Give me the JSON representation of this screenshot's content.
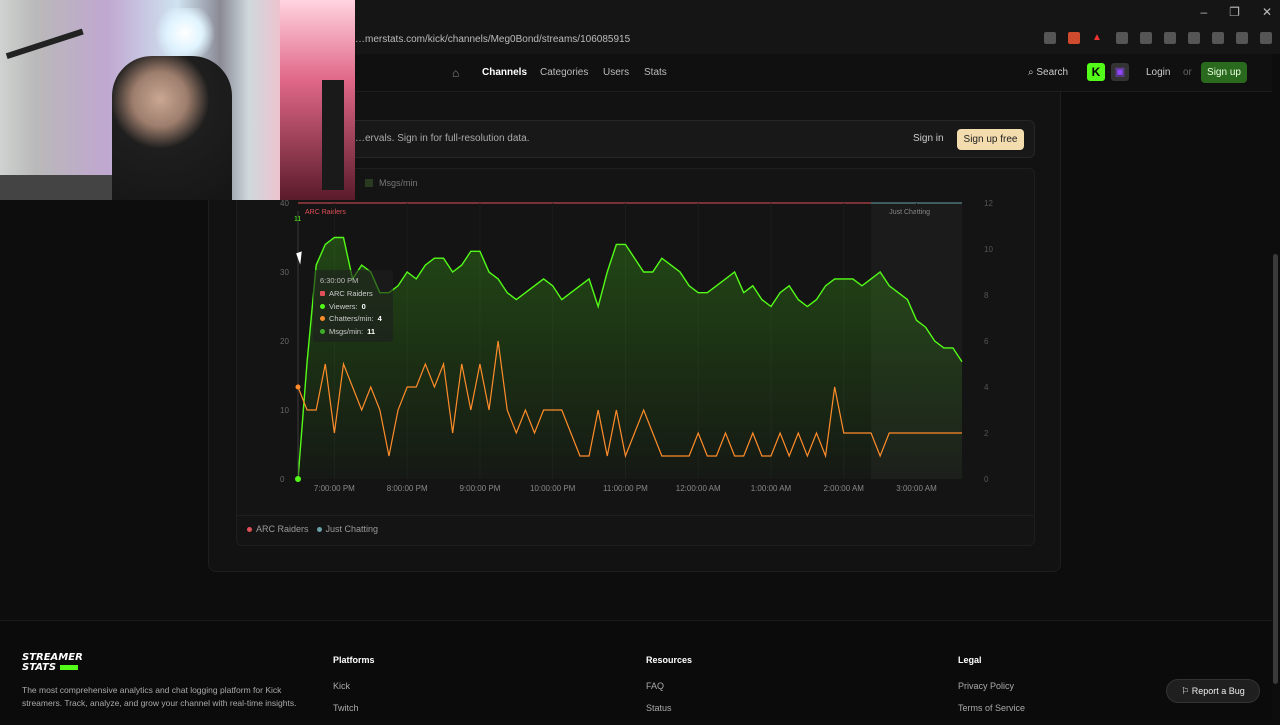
{
  "browser": {
    "url": "…merstats.com/kick/channels/Meg0Bond/streams/106085915",
    "window_controls": [
      "–",
      "❐",
      "✕"
    ]
  },
  "nav": {
    "links": [
      "Channels",
      "Categories",
      "Users",
      "Stats"
    ],
    "search_label": "Search",
    "kick_badge": "K",
    "login_label": "Login",
    "or_label": "or",
    "signup_label": "Sign up"
  },
  "notice": {
    "message": "…ervals. Sign in for full-resolution data.",
    "signin_label": "Sign in",
    "signup_free_label": "Sign up free"
  },
  "chart_legend_top": [
    "Msgs/min"
  ],
  "tooltip": {
    "time": "6:30:00 PM",
    "category": "ARC Raiders",
    "viewers_label": "Viewers:",
    "viewers_value": "0",
    "chatters_label": "Chatters/min:",
    "chatters_value": "4",
    "msgs_label": "Msgs/min:",
    "msgs_value": "11",
    "colors": {
      "category": "#e0505a",
      "viewers": "#53fc18",
      "chatters": "#ff8c2a",
      "msgs": "#3fae2a"
    }
  },
  "chart_data": {
    "type": "line",
    "x": [
      "6:30 PM",
      "6:37 PM",
      "6:45 PM",
      "6:52 PM",
      "7:00 PM",
      "7:07 PM",
      "7:15 PM",
      "7:22 PM",
      "7:30 PM",
      "7:37 PM",
      "7:45 PM",
      "7:52 PM",
      "8:00 PM",
      "8:07 PM",
      "8:15 PM",
      "8:22 PM",
      "8:30 PM",
      "8:37 PM",
      "8:45 PM",
      "8:52 PM",
      "9:00 PM",
      "9:07 PM",
      "9:15 PM",
      "9:22 PM",
      "9:30 PM",
      "9:37 PM",
      "9:45 PM",
      "9:52 PM",
      "10:00 PM",
      "10:07 PM",
      "10:15 PM",
      "10:22 PM",
      "10:30 PM",
      "10:37 PM",
      "10:45 PM",
      "10:52 PM",
      "11:00 PM",
      "11:07 PM",
      "11:15 PM",
      "11:22 PM",
      "11:30 PM",
      "11:37 PM",
      "11:45 PM",
      "11:52 PM",
      "12:00 AM",
      "12:07 AM",
      "12:15 AM",
      "12:22 AM",
      "12:30 AM",
      "12:37 AM",
      "12:45 AM",
      "12:52 AM",
      "1:00 AM",
      "1:07 AM",
      "1:15 AM",
      "1:22 AM",
      "1:30 AM",
      "1:37 AM",
      "1:45 AM",
      "1:52 AM",
      "2:00 AM",
      "2:07 AM",
      "2:15 AM",
      "2:22 AM",
      "2:30 AM",
      "2:37 AM",
      "2:45 AM",
      "2:52 AM",
      "3:00 AM",
      "3:07 AM",
      "3:15 AM",
      "3:22 AM",
      "3:30 AM",
      "3:37 AM"
    ],
    "xticks": [
      "7:00:00 PM",
      "8:00:00 PM",
      "9:00:00 PM",
      "10:00:00 PM",
      "11:00:00 PM",
      "12:00:00 AM",
      "1:00:00 AM",
      "2:00:00 AM",
      "3:00:00 AM"
    ],
    "xtick_index": [
      4,
      12,
      20,
      28,
      36,
      44,
      52,
      60,
      68
    ],
    "y_left_ticks": [
      "0",
      "10",
      "20",
      "30",
      "40"
    ],
    "y_right_ticks": [
      "0",
      "2",
      "4",
      "6",
      "8",
      "10",
      "12"
    ],
    "ylim_left": [
      0,
      40
    ],
    "ylim_right": [
      0,
      12
    ],
    "series": [
      {
        "name": "Viewers",
        "axis": "left",
        "color": "#53fc18",
        "values": [
          0,
          17,
          31,
          34,
          35,
          35,
          29,
          31,
          30,
          27,
          27,
          28,
          30,
          29,
          31,
          32,
          32,
          30,
          31,
          33,
          33,
          30,
          29,
          27,
          26,
          27,
          28,
          29,
          28,
          26,
          27,
          28,
          29,
          25,
          30,
          34,
          34,
          32,
          30,
          30,
          32,
          31,
          30,
          28,
          27,
          27,
          28,
          29,
          30,
          27,
          28,
          26,
          25,
          27,
          28,
          26,
          25,
          26,
          28,
          29,
          29,
          29,
          28,
          29,
          30,
          28,
          27,
          26,
          23,
          22,
          20,
          19,
          19,
          17
        ]
      },
      {
        "name": "Chatters/min",
        "axis": "right",
        "color": "#ff8c2a",
        "values": [
          4,
          3,
          3,
          5,
          2,
          5,
          4,
          3,
          4,
          3,
          1,
          3,
          4,
          4,
          5,
          4,
          5,
          2,
          5,
          3,
          5,
          3,
          6,
          3,
          2,
          3,
          2,
          3,
          3,
          3,
          2,
          1,
          1,
          3,
          1,
          3,
          1,
          2,
          3,
          2,
          1,
          1,
          1,
          1,
          2,
          1,
          1,
          2,
          1,
          1,
          2,
          1,
          1,
          2,
          1,
          2,
          1,
          2,
          1,
          4,
          2,
          2,
          2,
          2,
          1,
          2,
          2,
          2,
          2,
          2,
          2,
          2,
          2,
          2
        ]
      }
    ],
    "categories_bands": [
      {
        "name": "ARC Raiders",
        "color": "#e0505a"
      },
      {
        "name": "Just Chatting",
        "color": "#6aa0a8"
      }
    ],
    "grid": true
  },
  "chart_legend_bottom": [
    "ARC Raiders",
    "Just Chatting"
  ],
  "footer": {
    "logo_line1": "STREAMER",
    "logo_line2": "STATS",
    "description": "The most comprehensive analytics and chat logging platform for Kick streamers. Track, analyze, and grow your channel with real-time insights.",
    "columns": [
      {
        "title": "Platforms",
        "items": [
          "Kick",
          "Twitch"
        ]
      },
      {
        "title": "Resources",
        "items": [
          "FAQ",
          "Status"
        ]
      },
      {
        "title": "Legal",
        "items": [
          "Privacy Policy",
          "Terms of Service"
        ]
      }
    ],
    "report_bug_label": "Report a Bug"
  }
}
